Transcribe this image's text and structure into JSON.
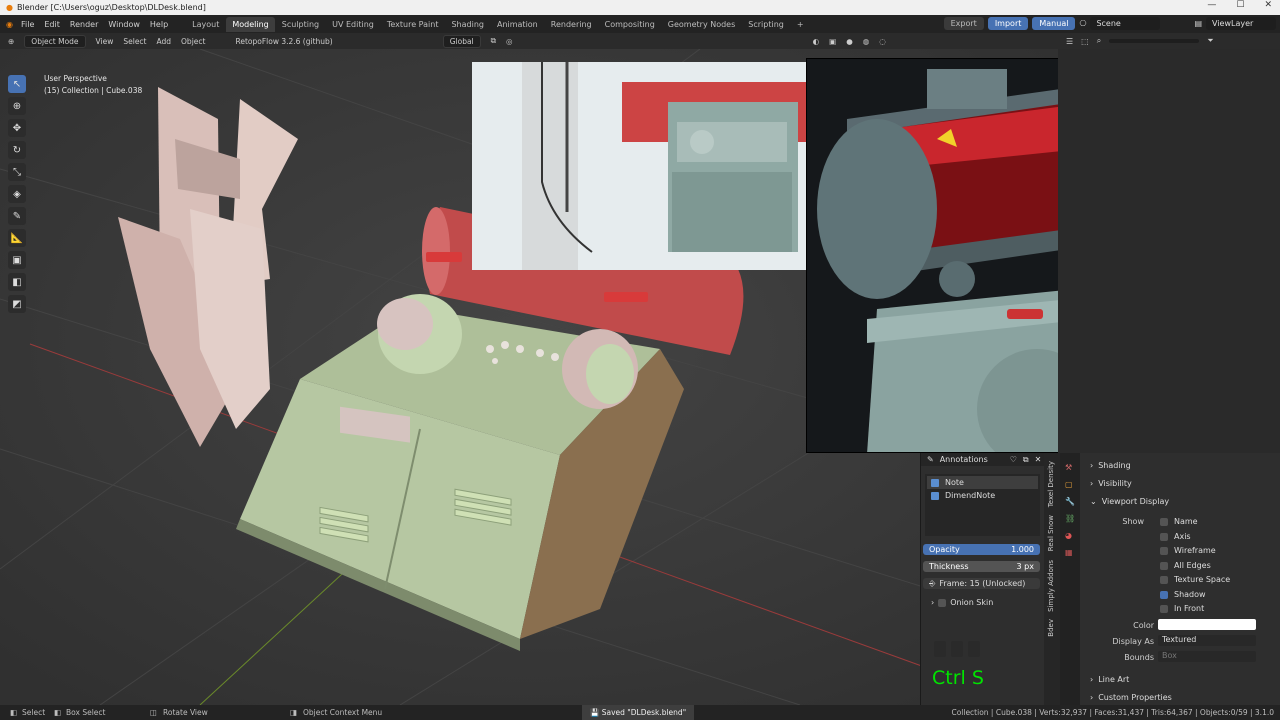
{
  "window": {
    "title": "Blender [C:\\Users\\oguz\\Desktop\\DLDesk.blend]"
  },
  "menu": [
    "File",
    "Edit",
    "Render",
    "Window",
    "Help"
  ],
  "workspaces": [
    "Layout",
    "Modeling",
    "Sculpting",
    "UV Editing",
    "Texture Paint",
    "Shading",
    "Animation",
    "Rendering",
    "Compositing",
    "Geometry Nodes",
    "Scripting"
  ],
  "active_workspace": "Modeling",
  "topbar": {
    "export": "Export",
    "import": "Import",
    "manual": "Manual",
    "scene": "Scene",
    "viewlayer": "ViewLayer"
  },
  "header": {
    "mode": "Object Mode",
    "view": "View",
    "select": "Select",
    "add": "Add",
    "object": "Object",
    "addon": "RetopoFlow 3.2.6 (github)",
    "orientation": "Global"
  },
  "overlay": {
    "perspective": "User Perspective",
    "collection": "(15) Collection | Cube.038"
  },
  "annotations": {
    "title": "Annotations",
    "layers": [
      "Note",
      "DimendNote"
    ],
    "opacity_label": "Opacity",
    "opacity_value": "1.000",
    "thickness_label": "Thickness",
    "thickness_value": "3 px",
    "frame": "Frame: 15 (Unlocked)",
    "onion": "Onion Skin"
  },
  "vertical_tabs": [
    "Texel Density",
    "Real Snow",
    "Simply Addons",
    "Bdev"
  ],
  "properties": {
    "shading": "Shading",
    "visibility": "Visibility",
    "viewport_display": "Viewport Display",
    "show_label": "Show",
    "name": "Name",
    "axis": "Axis",
    "wireframe": "Wireframe",
    "all_edges": "All Edges",
    "texture_space": "Texture Space",
    "shadow": "Shadow",
    "in_front": "In Front",
    "color_label": "Color",
    "display_as_label": "Display As",
    "display_as_value": "Textured",
    "bounds_label": "Bounds",
    "bounds_value": "Box",
    "line_art": "Line Art",
    "custom_properties": "Custom Properties"
  },
  "keystroke": "Ctrl S",
  "status": {
    "select": "Select",
    "box_select": "Box Select",
    "rotate_view": "Rotate View",
    "context_menu": "Object Context Menu",
    "saved": "Saved \"DLDesk.blend\"",
    "stats": "Collection | Cube.038 | Verts:32,937 | Faces:31,437 | Tris:64,367 | Objects:0/59 | 3.1.0"
  }
}
